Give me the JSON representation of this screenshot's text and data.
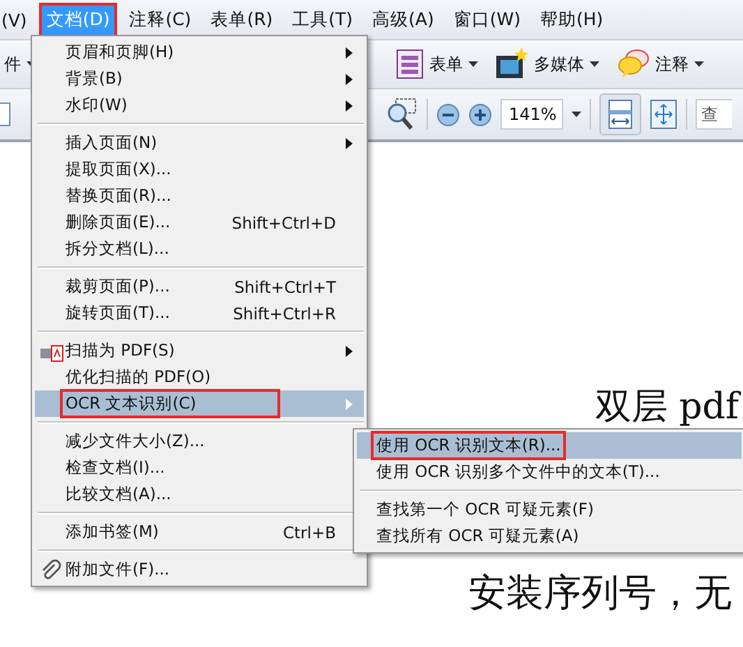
{
  "menubar": [
    {
      "label": "(V)",
      "selected": false,
      "highlighted": false
    },
    {
      "label": "文档(D)",
      "selected": true,
      "highlighted": true
    },
    {
      "label": "注释(C)",
      "selected": false,
      "highlighted": false
    },
    {
      "label": "表单(R)",
      "selected": false,
      "highlighted": false
    },
    {
      "label": "工具(T)",
      "selected": false,
      "highlighted": false
    },
    {
      "label": "高级(A)",
      "selected": false,
      "highlighted": false
    },
    {
      "label": "窗口(W)",
      "selected": false,
      "highlighted": false
    },
    {
      "label": "帮助(H)",
      "selected": false,
      "highlighted": false
    }
  ],
  "toolbar": {
    "row_1": [
      {
        "kind": "dropdown",
        "label": "件"
      },
      {
        "kind": "form",
        "label": "表单"
      },
      {
        "kind": "media",
        "label": "多媒体"
      },
      {
        "kind": "comment",
        "label": "注释"
      }
    ],
    "row_2": {
      "zoom": "141%",
      "search": "查",
      "fit_width_pressed": true
    }
  },
  "document": {
    "heading": "双层 pdf",
    "line": "安装序列号，无"
  },
  "menu": [
    {
      "kind": "item",
      "label": "页眉和页脚(H)",
      "submenu": true,
      "selected": false,
      "highlighted": false
    },
    {
      "kind": "item",
      "label": "背景(B)",
      "submenu": true,
      "selected": false,
      "highlighted": false
    },
    {
      "kind": "item",
      "label": "水印(W)",
      "submenu": true,
      "selected": false,
      "highlighted": false
    },
    {
      "kind": "separator"
    },
    {
      "kind": "item",
      "label": "插入页面(N)",
      "submenu": true,
      "selected": false,
      "highlighted": false
    },
    {
      "kind": "item",
      "label": "提取页面(X)...",
      "selected": false,
      "highlighted": false
    },
    {
      "kind": "item",
      "label": "替换页面(R)...",
      "selected": false,
      "highlighted": false
    },
    {
      "kind": "item",
      "label": "删除页面(E)...",
      "shortcut": "Shift+Ctrl+D",
      "selected": false,
      "highlighted": false
    },
    {
      "kind": "item",
      "label": "拆分文档(L)...",
      "selected": false,
      "highlighted": false
    },
    {
      "kind": "separator"
    },
    {
      "kind": "item",
      "label": "裁剪页面(P)...",
      "shortcut": "Shift+Ctrl+T",
      "selected": false,
      "highlighted": false
    },
    {
      "kind": "item",
      "label": "旋转页面(T)...",
      "shortcut": "Shift+Ctrl+R",
      "selected": false,
      "highlighted": false
    },
    {
      "kind": "separator"
    },
    {
      "kind": "scan",
      "label": "扫描为 PDF(S)",
      "submenu": true,
      "selected": false,
      "highlighted": false
    },
    {
      "kind": "item",
      "label": "优化扫描的 PDF(O)",
      "selected": false,
      "highlighted": false
    },
    {
      "kind": "item",
      "label": "OCR 文本识别(C)",
      "submenu": true,
      "selected": true,
      "highlighted": true
    },
    {
      "kind": "separator"
    },
    {
      "kind": "item",
      "label": "减少文件大小(Z)...",
      "selected": false,
      "highlighted": false
    },
    {
      "kind": "item",
      "label": "检查文档(I)...",
      "selected": false,
      "highlighted": false
    },
    {
      "kind": "item",
      "label": "比较文档(A)...",
      "selected": false,
      "highlighted": false
    },
    {
      "kind": "separator"
    },
    {
      "kind": "item",
      "label": "添加书签(M)",
      "shortcut": "Ctrl+B",
      "selected": false,
      "highlighted": false
    },
    {
      "kind": "separator"
    },
    {
      "kind": "attach",
      "label": "附加文件(F)...",
      "selected": false,
      "highlighted": false
    }
  ],
  "submenu": [
    {
      "kind": "item",
      "label": "使用 OCR 识别文本(R)...",
      "selected": true,
      "highlighted": true
    },
    {
      "kind": "item",
      "label": "使用 OCR 识别多个文件中的文本(T)...",
      "selected": false,
      "highlighted": false
    },
    {
      "kind": "separator"
    },
    {
      "kind": "item",
      "label": "查找第一个 OCR 可疑元素(F)",
      "selected": false,
      "highlighted": false
    },
    {
      "kind": "item",
      "label": "查找所有 OCR 可疑元素(A)",
      "selected": false,
      "highlighted": false
    }
  ]
}
